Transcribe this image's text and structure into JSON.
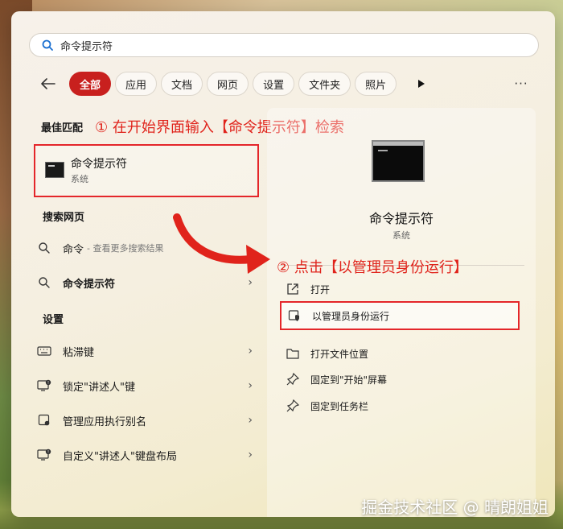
{
  "search": {
    "value": "命令提示符"
  },
  "filters": {
    "tabs": [
      {
        "label": "全部",
        "active": true
      },
      {
        "label": "应用",
        "active": false
      },
      {
        "label": "文档",
        "active": false
      },
      {
        "label": "网页",
        "active": false
      },
      {
        "label": "设置",
        "active": false
      },
      {
        "label": "文件夹",
        "active": false
      },
      {
        "label": "照片",
        "active": false
      }
    ],
    "more_label": "···"
  },
  "left": {
    "best_match_heading": "最佳匹配",
    "best_match": {
      "title": "命令提示符",
      "subtitle": "系统",
      "icon": "cmd-icon"
    },
    "web_heading": "搜索网页",
    "web_items": [
      {
        "label": "命令",
        "hint": "- 查看更多搜索结果",
        "icon": "search-icon"
      },
      {
        "label": "命令提示符",
        "hint": "",
        "icon": "search-icon"
      }
    ],
    "settings_heading": "设置",
    "settings_items": [
      {
        "label": "粘滞键",
        "icon": "keyboard-icon"
      },
      {
        "label": "锁定\"讲述人\"键",
        "icon": "narrator-icon"
      },
      {
        "label": "管理应用执行别名",
        "icon": "app-settings-icon"
      },
      {
        "label": "自定义\"讲述人\"键盘布局",
        "icon": "narrator-icon"
      }
    ]
  },
  "annotations": {
    "step1": "① 在开始界面输入【命令提示符】检索",
    "step2": "② 点击【以管理员身份运行】"
  },
  "detail": {
    "title": "命令提示符",
    "subtitle": "系统",
    "actions": [
      {
        "label": "打开",
        "icon": "open-icon"
      },
      {
        "label": "以管理员身份运行",
        "icon": "shield-icon",
        "highlight": true
      },
      {
        "label": "打开文件位置",
        "icon": "folder-icon"
      },
      {
        "label": "固定到\"开始\"屏幕",
        "icon": "pin-icon"
      },
      {
        "label": "固定到任务栏",
        "icon": "pin-icon"
      }
    ]
  },
  "watermark": "掘金技术社区 @ 晴朗姐姐",
  "colors": {
    "accent": "#c8201e",
    "annotation": "#e0231b"
  }
}
